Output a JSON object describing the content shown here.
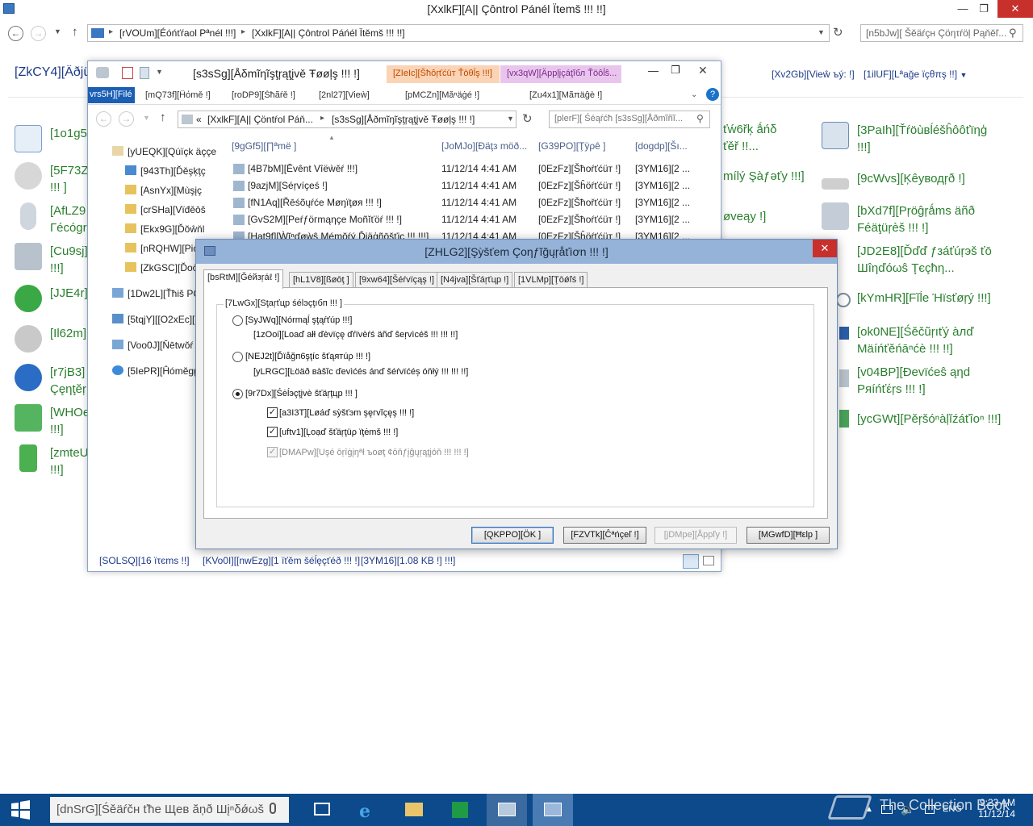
{
  "control_panel": {
    "title": "[XxlkF][A|| Çôntrol Pánél Ïtemš !!! !!]",
    "address": {
      "segment1": "[rVOUm][Éóńťŕaol Pªnél !!!]",
      "segment2": "[XxlkF][A|| Çôntrol Páńél Ïtěmš !!! !!]"
    },
    "search_placeholder": "[n5bJw][ Šěäŕçн Çöητŕöļ Pąňěľ...",
    "heading": "[ZkCY4][Äðjü",
    "view_by": "[Xv2Gb][Vieŵ ъý: !]",
    "view_value": "[1ilUF][Lªaǧe ïçθπş !!]",
    "items_left": [
      {
        "label": "[1o1g5",
        "icon": "calendar-icon"
      },
      {
        "label": "[5F73Z\n!!! ]",
        "icon": "magnifier-icon"
      },
      {
        "label": "[AfLZ9\nГécógr",
        "icon": "microphone-icon"
      },
      {
        "label": "[Cu9sj]\n!!!]",
        "icon": "computer-icon"
      },
      {
        "label": "[JJE4r]",
        "icon": "sync-icon"
      },
      {
        "label": "[Il62m]",
        "icon": "speaker-icon"
      },
      {
        "label": "[r7jB3]\nÇęηţĕŗ",
        "icon": "ease-of-access-icon"
      },
      {
        "label": "[WHOe\n!!!]",
        "icon": "mobility-icon"
      },
      {
        "label": "[zmteU\n!!!]",
        "icon": "power-icon"
      }
    ],
    "items_middle": [
      {
        "label": "ťẃ6řķ ǻńδ\nťěř !!..."
      },
      {
        "label": "mílý Şàƒəťу !!!]"
      },
      {
        "label": "øveąy !]"
      }
    ],
    "items_right": [
      {
        "label": "[3PaIh][Ťŕöùвĺéšĥôôťïηģ\n!!!]",
        "icon": "troubleshoot-icon"
      },
      {
        "label": "[9cWvs][Ķêуводŗð !]",
        "icon": "keyboard-icon"
      },
      {
        "label": "[bXd7f][Pŗöĝŗǻms äñð\nFéäţüŗèš !!! !]",
        "icon": "programs-icon"
      },
      {
        "label": "[JD2E8][Ďďď ƒзáťúŗэš ťō\nШîηďóωŝ Ţєçħη...",
        "icon": "windows-features-icon"
      },
      {
        "label": "[kYmHR][Fĭĺe Ήïsťøŗý !!!]",
        "icon": "file-history-icon"
      },
      {
        "label": "[ok0NE][Śěčũŗıťý àлď\nMäíńťěńāⁿćè !!! !!]",
        "icon": "security-flag-icon"
      },
      {
        "label": "[v04BP][Ðevïćeŝ ąηd\nPяíńťέŗs !!! !]",
        "icon": "printer-icon"
      },
      {
        "label": "[ycGWt][Pěŗšóⁿàļĭźáťîoⁿ !!!]",
        "icon": "personalization-icon"
      }
    ]
  },
  "explorer": {
    "title": "[s3sSg][Åδmĩηĩşţŗąţįvě Ŧøøļş !!! !]",
    "tools_tab": "[ZIeIc][Šħôŗťćüт Ťöθĺş !!!]",
    "apps_tab": "[vx3qW][Äppļįçáţĭбл Ťöôĺŝ...",
    "file_tab": "vrs5H][Filé",
    "ribbon_tabs": [
      "[mQ73f][Ĥόmě !]",
      "[roDP9][Šħãŕě !]",
      "[2nl27][Vieẁ]",
      "[pMCZn][Măⁿäġé !]",
      "[Zu4x1][Mãπäĝè !]"
    ],
    "breadcrumb": {
      "prefix": "«",
      "part1": "[XxlkF][A|| Çöntŕol Páň...",
      "part2": "[s3sSg][Åðmĩŋĩşţŗąţįvě Ŧøøļş !!! !]"
    },
    "search_placeholder": "[plerF][ Śéąŕćħ [s3sSg][Åðmĩñĩ...",
    "tree": [
      {
        "label": "[yUEQK][Qúïçk äççe",
        "icon": "home-icon"
      },
      {
        "label": "[943Th][Ďěşķţç",
        "icon": "desktop-icon"
      },
      {
        "label": "[AsnYx][Mùşįç",
        "icon": "music-folder-icon"
      },
      {
        "label": "[crSHa][Vïđěōš",
        "icon": "videos-folder-icon"
      },
      {
        "label": "[Ekx9G][Ďŏŵňl",
        "icon": "downloads-folder-icon"
      },
      {
        "label": "[nRQHW][Pic",
        "icon": "pictures-folder-icon"
      },
      {
        "label": "[ZkGSC][Ďoċ",
        "icon": "documents-folder-icon"
      },
      {
        "label": "[1Dw2L][Ťħiš PČ",
        "icon": "this-pc-icon"
      },
      {
        "label": "[5tqjY][[O2xEc][",
        "icon": "libraries-icon"
      },
      {
        "label": "[Voo0J][Ňētwŏŕ",
        "icon": "network-icon"
      },
      {
        "label": "[5IePR][Ĥómĕgŗ",
        "icon": "homegroup-icon"
      }
    ],
    "columns": {
      "name": "[9gGf5][∏ªmë ]",
      "date": "[JoMJo][Ðäţз möð...",
      "type": "[G39PO][Ţÿρê ]",
      "size": "[dogdp][Šı..."
    },
    "rows": [
      {
        "name": "[4B7bM][Ēvênt Vîëẁěŕ !!!]",
        "date": "11/12/14 4:41 AM",
        "type": "[0EzFz][Šħoŕťćüт !]",
        "size": "[3YM16][2 ..."
      },
      {
        "name": "[9azjM][Séŗvíçeś !]",
        "date": "11/12/14 4:41 AM",
        "type": "[0EzFz][Šĥöŕťćüт !]",
        "size": "[3YM16][2 ..."
      },
      {
        "name": "[fN1Aq][Řēśõųŕćе Møŋïţøя !!! !]",
        "date": "11/12/14 4:41 AM",
        "type": "[0EzFz][Šħořťćüт !]",
        "size": "[3YM16][2 ..."
      },
      {
        "name": "[GvS2M][Peŕƒöгmąηçе Moñĭťöŕ !!! !]",
        "date": "11/12/14 4:41 AM",
        "type": "[0EzFz][Šħoŕťćüт !]",
        "size": "[3YM16][2 ..."
      },
      {
        "name": "[Hat9f][Ẁĭⁿďøẁŝ Mémŏŕý Ďįäģñōšťįc !!! !!!]",
        "date": "11/12/14 4:41 AM",
        "type": "[0EzFz][Šĥöŕťćüт !]",
        "size": "[3YM16][2 ..."
      }
    ],
    "status": {
      "items": "[SOLSQ][16 ïτєms !!]",
      "selected": "[KVo0I][[nwEzg][1 ïťěm šéĺęçťéð !!! !]",
      "size": "[3YM16][1.08 KB !] !!!]"
    }
  },
  "dialog": {
    "title": "[ZHLG2][Şỳšťеm Çoηƒĭğųŗåťìơn !!! !]",
    "tabs": [
      "[bsRtM][Ğéйзŗáℓ !]",
      "[hL1V8][ßøōţ ]",
      "[9xw64][Šéŕvïçąş !]",
      "[N4jva][Šťáŗťцp !]",
      "[1VLMp][Ţōǿľś !]"
    ],
    "group_legend": "[7LwGx][Sţаŗťцр śéĺэçţıбп !!! ]",
    "options": {
      "normal": {
        "label": "[SyJWq][Nórmąĺ şţąŕťúр !!!]",
        "desc": "[1zOoi][Loaď ałł ďèvïçę ďŕïvèŕś äñď ŝеŗvìcéš !!! !!! !!]"
      },
      "diagnostic": {
        "label": "[NEJ2t][Ďïåğп6şţíc šťąятúρ !!! !]",
        "desc": "[yLRGC][Ŀöäð вàšĭc ďevìćés ánď šéŕvïćéș óňłý !!! !!! !!]"
      },
      "selective": {
        "label": "[9r7Dx][Śėĺэçţįvè šťäŗţцр !!! ]"
      },
      "load_system": "[a3I3T][Løáď sỳšťэm şęгvĭçęş !!! !]",
      "load_startup": "[uftv1][Ļoạď šťäŗţüρ ïţėmš !!! !]",
      "use_boot": "[DMAPw][Uşé ōŗīġįŋªł ъoøţ ¢ōňƒįĝųŗąţįóň !!! !!! !]"
    },
    "buttons": {
      "ok": "[QKPPO][ÖK ]",
      "cancel": "[FZVTk][Ĉªńçеľ !]",
      "apply": "[jDMpe][Åppľу !]",
      "help": "[MGwfD][Ħεlр ]"
    }
  },
  "taskbar": {
    "search_placeholder": "[dnSrG][Śěäŕčн ťħе Щев ăņð Шįⁿδǿωš",
    "lang": "ENG",
    "time": "9:23 AM",
    "date": "11/12/14",
    "watermark": "The Collection Book"
  },
  "colors": {
    "link_green": "#2a7f2e",
    "link_blue": "#1e3a8a",
    "dialog_title": "#95b2d8",
    "close_red": "#c7302b",
    "taskbar": "#0c4a8c"
  }
}
